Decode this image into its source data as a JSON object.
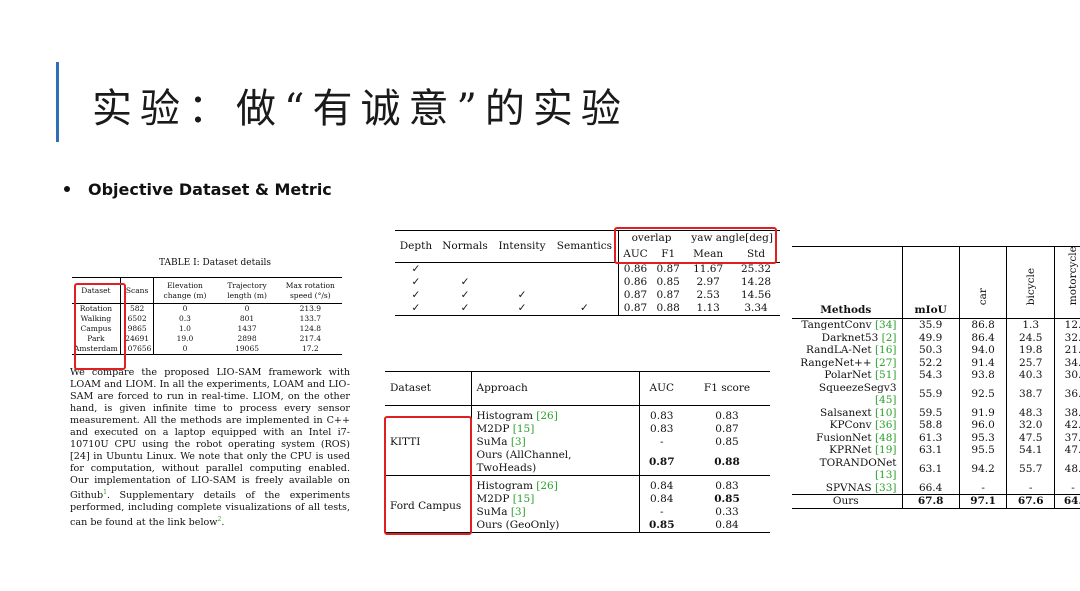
{
  "slide": {
    "title": "实验：做“有诚意”的实验",
    "bullet": "Objective Dataset & Metric"
  },
  "dataset_details": {
    "caption": "TABLE I: Dataset details",
    "headers": [
      "Dataset",
      "Scans",
      "Elevation change (m)",
      "Trajectory length (m)",
      "Max rotation speed (°/s)"
    ],
    "rows": [
      [
        "Rotation",
        "582",
        "0",
        "0",
        "213.9"
      ],
      [
        "Walking",
        "6502",
        "0.3",
        "801",
        "133.7"
      ],
      [
        "Campus",
        "9865",
        "1.0",
        "1437",
        "124.8"
      ],
      [
        "Park",
        "24691",
        "19.0",
        "2898",
        "217.4"
      ],
      [
        "Amsterdam",
        "107656",
        "0",
        "19065",
        "17.2"
      ]
    ],
    "paragraph_parts": [
      "We compare the proposed LIO-SAM framework with LOAM and LIOM. In all the experiments, LOAM and LIO-SAM are forced to run in real-time. LIOM, on the other hand, is given infinite time to process every sensor measurement. All the methods are implemented in C++ and executed on a laptop equipped with an Intel i7-10710U CPU using the robot operating system (ROS) [24] in Ubuntu Linux. We note that only the CPU is used for computation, without parallel computing enabled. Our implementation of LIO-SAM is freely available on Github",
      "1",
      ". Supplementary details of the experiments performed, including complete visualizations of all tests, can be found at the link below",
      "2",
      "."
    ]
  },
  "features_table": {
    "col_headers": [
      "Depth",
      "Normals",
      "Intensity",
      "Semantics"
    ],
    "group_headers": [
      "overlap",
      "yaw angle[deg]"
    ],
    "sub_headers": [
      "AUC",
      "F1",
      "Mean",
      "Std"
    ],
    "rows": [
      {
        "checks": [
          "✓",
          "",
          "",
          ""
        ],
        "vals": [
          "0.86",
          "0.87",
          "11.67",
          "25.32"
        ]
      },
      {
        "checks": [
          "✓",
          "✓",
          "",
          ""
        ],
        "vals": [
          "0.86",
          "0.85",
          "2.97",
          "14.28"
        ]
      },
      {
        "checks": [
          "✓",
          "✓",
          "✓",
          ""
        ],
        "vals": [
          "0.87",
          "0.87",
          "2.53",
          "14.56"
        ]
      },
      {
        "checks": [
          "✓",
          "✓",
          "✓",
          "✓"
        ],
        "vals": [
          "0.87",
          "0.88",
          "1.13",
          "3.34"
        ]
      }
    ]
  },
  "approach_table": {
    "headers": [
      "Dataset",
      "Approach",
      "AUC",
      "F1 score"
    ],
    "groups": [
      {
        "dataset": "KITTI",
        "rows": [
          {
            "pre": "Histogram ",
            "ref": "[26]",
            "auc": "0.83",
            "f1": "0.83",
            "bold": false
          },
          {
            "pre": "M2DP ",
            "ref": "[15]",
            "auc": "0.83",
            "f1": "0.87",
            "bold": false
          },
          {
            "pre": "SuMa ",
            "ref": "[3]",
            "auc": "-",
            "f1": "0.85",
            "bold": false
          },
          {
            "pre": "Ours (AllChannel, TwoHeads)",
            "ref": "",
            "auc": "0.87",
            "f1": "0.88",
            "bold": true
          }
        ]
      },
      {
        "dataset": "Ford Campus",
        "rows": [
          {
            "pre": "Histogram ",
            "ref": "[26]",
            "auc": "0.84",
            "f1": "0.83",
            "bold": false
          },
          {
            "pre": "M2DP ",
            "ref": "[15]",
            "auc": "0.84",
            "f1": "0.85",
            "bold": false
          },
          {
            "pre": "SuMa ",
            "ref": "[3]",
            "auc": "-",
            "f1": "0.33",
            "bold": false
          },
          {
            "pre": "Ours (GeoOnly)",
            "ref": "",
            "auc": "0.85",
            "f1": "0.84",
            "bold": false
          }
        ]
      }
    ]
  },
  "methods_table": {
    "headers": [
      "Methods",
      "mIoU",
      "car",
      "bicycle",
      "motorcycle"
    ],
    "rows": [
      {
        "name": "TangentConv ",
        "ref": "[34]",
        "vals": [
          "35.9",
          "86.8",
          "1.3",
          "12."
        ]
      },
      {
        "name": "Darknet53 ",
        "ref": "[2]",
        "vals": [
          "49.9",
          "86.4",
          "24.5",
          "32."
        ]
      },
      {
        "name": "RandLA-Net ",
        "ref": "[16]",
        "vals": [
          "50.3",
          "94.0",
          "19.8",
          "21."
        ]
      },
      {
        "name": "RangeNet++ ",
        "ref": "[27]",
        "vals": [
          "52.2",
          "91.4",
          "25.7",
          "34."
        ]
      },
      {
        "name": "PolarNet ",
        "ref": "[51]",
        "vals": [
          "54.3",
          "93.8",
          "40.3",
          "30."
        ]
      },
      {
        "name": "SqueezeSegv3 ",
        "ref": "[45]",
        "vals": [
          "55.9",
          "92.5",
          "38.7",
          "36."
        ]
      },
      {
        "name": "Salsanext ",
        "ref": "[10]",
        "vals": [
          "59.5",
          "91.9",
          "48.3",
          "38."
        ]
      },
      {
        "name": "KPConv ",
        "ref": "[36]",
        "vals": [
          "58.8",
          "96.0",
          "32.0",
          "42."
        ]
      },
      {
        "name": "FusionNet ",
        "ref": "[48]",
        "vals": [
          "61.3",
          "95.3",
          "47.5",
          "37."
        ]
      },
      {
        "name": "KPRNet ",
        "ref": "[19]",
        "vals": [
          "63.1",
          "95.5",
          "54.1",
          "47."
        ]
      },
      {
        "name": "TORANDONet ",
        "ref": "[13]",
        "vals": [
          "63.1",
          "94.2",
          "55.7",
          "48."
        ]
      },
      {
        "name": "SPVNAS ",
        "ref": "[33]",
        "vals": [
          "66.4",
          "-",
          "-",
          "-"
        ]
      }
    ],
    "ours": {
      "name": "Ours",
      "vals": [
        "67.8",
        "97.1",
        "67.6",
        "64."
      ]
    }
  }
}
